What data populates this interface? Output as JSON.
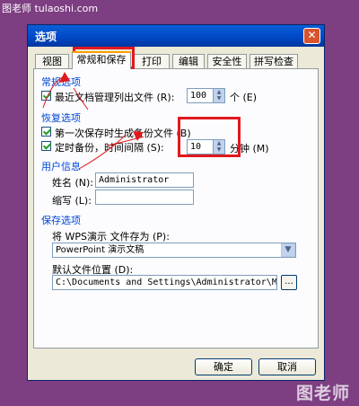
{
  "watermark": {
    "top": "图老师 tulaoshi.com",
    "bottom": "图老师"
  },
  "dialog": {
    "title": "选项",
    "close": "✕"
  },
  "tabs": [
    {
      "label": "视图"
    },
    {
      "label": "常规和保存",
      "active": true
    },
    {
      "label": "打印"
    },
    {
      "label": "编辑"
    },
    {
      "label": "安全性"
    },
    {
      "label": "拼写检查"
    }
  ],
  "general": {
    "title": "常规选项",
    "recent_label": "最近文档管理列出文件 (R):",
    "recent_value": "100",
    "recent_unit": "个 (E)"
  },
  "recovery": {
    "title": "恢复选项",
    "first_backup_label": "第一次保存时生成备份文件 (B)",
    "timed_backup_label": "定时备份，时间间隔 (S):",
    "interval_value": "10",
    "interval_unit": "分钟 (M)"
  },
  "userinfo": {
    "title": "用户信息",
    "name_label": "姓名 (N):",
    "name_value": "Administrator",
    "initials_label": "缩写 (L):",
    "initials_value": ""
  },
  "save": {
    "title": "保存选项",
    "format_label": "将 WPS演示 文件存为 (P):",
    "format_value": "PowerPoint 演示文稿",
    "path_label": "默认文件位置 (D):",
    "path_value": "C:\\Documents and Settings\\Administrator\\My Doc",
    "browse": "..."
  },
  "buttons": {
    "ok": "确定",
    "cancel": "取消"
  },
  "colors": {
    "annotation": "#e0191f",
    "background": "#7d3e82",
    "accent": "#0046d5"
  }
}
